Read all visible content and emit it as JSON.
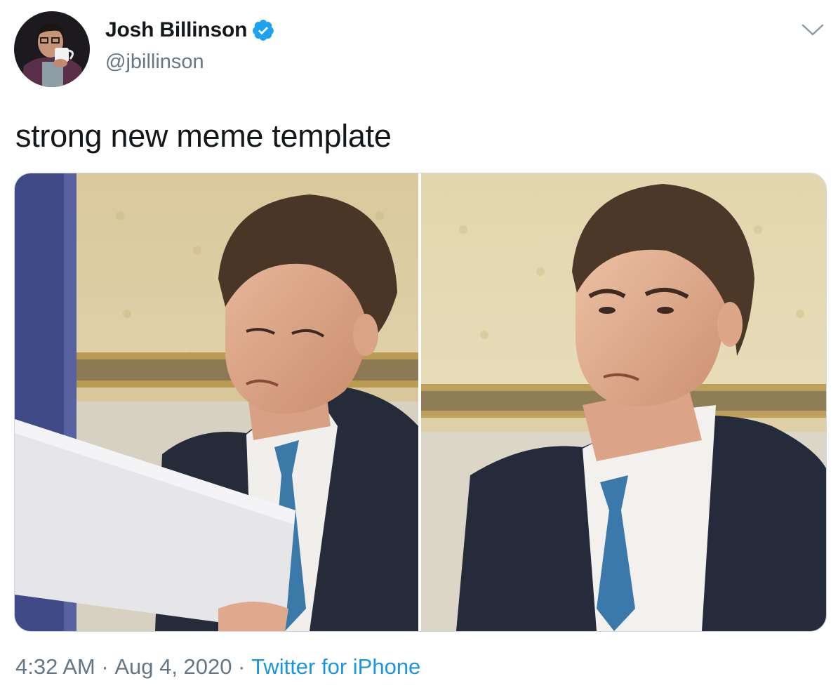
{
  "author": {
    "name": "Josh Billinson",
    "handle": "@jbillinson",
    "verified": true,
    "avatar_icon": "person-drinking-from-mug-avatar"
  },
  "tweet": {
    "text": "strong new meme template"
  },
  "media": {
    "count": 2,
    "panels": [
      {
        "subject": "man in suit squinting at paper"
      },
      {
        "subject": "man in suit squinting in confusion"
      }
    ]
  },
  "meta": {
    "time": "4:32 AM",
    "sep1": " · ",
    "date": "Aug 4, 2020",
    "sep2": " · ",
    "source": "Twitter for iPhone"
  },
  "icons": {
    "verified": "verified-badge-icon",
    "menu": "chevron-down-icon"
  },
  "colors": {
    "text": "#14171a",
    "secondary": "#657786",
    "link": "#1b95e0",
    "verified": "#1da1f2",
    "border": "#ccd6dd"
  }
}
